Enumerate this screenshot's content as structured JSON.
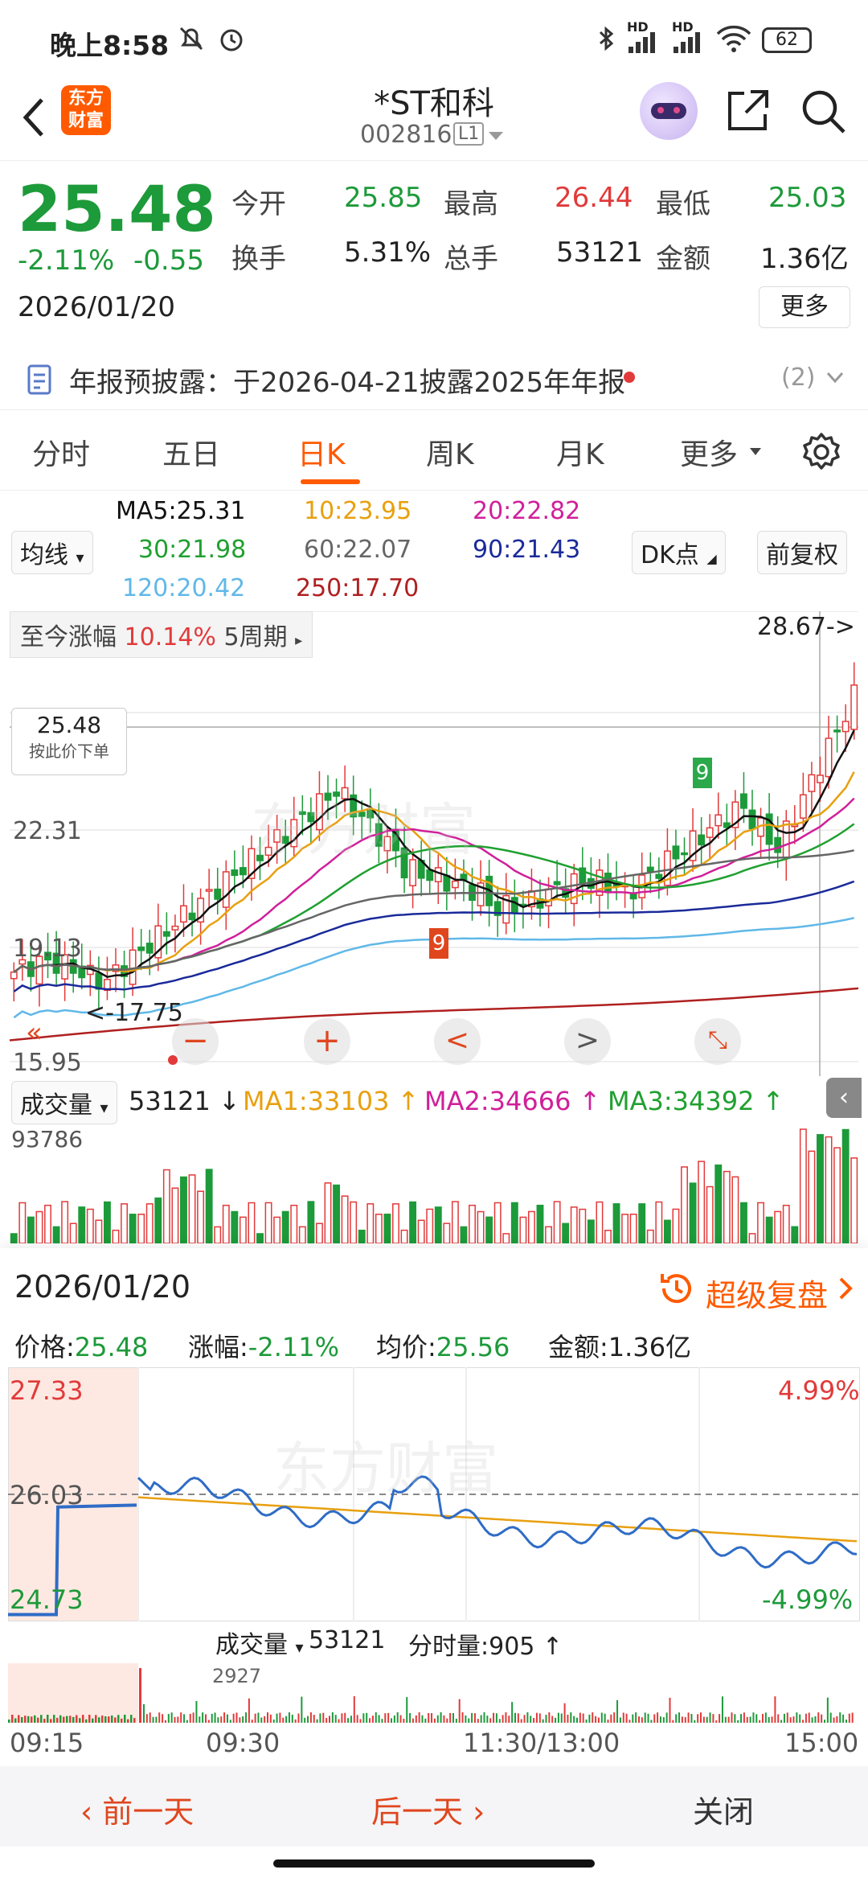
{
  "status": {
    "time": "晚上8:58",
    "battery": "62",
    "hd1": "HD",
    "hd2": "HD"
  },
  "header": {
    "title": "*ST和科",
    "code": "002816",
    "level": "L1",
    "logo_line1": "东方",
    "logo_line2": "财富"
  },
  "quote": {
    "price": "25.48",
    "change_pct": "-2.11%",
    "change": "-0.55",
    "date": "2026/01/20",
    "stats": [
      {
        "label": "今开",
        "value": "25.85"
      },
      {
        "label": "最高",
        "value": "26.44"
      },
      {
        "label": "最低",
        "value": "25.03"
      },
      {
        "label": "换手",
        "value": "5.31%"
      },
      {
        "label": "总手",
        "value": "53121"
      },
      {
        "label": "金额",
        "value": "1.36亿"
      }
    ],
    "more_label": "更多"
  },
  "notice": {
    "text": "年报预披露：于2026-04-21披露2025年年报",
    "count": "(2)"
  },
  "tabs": [
    "分时",
    "五日",
    "日K",
    "周K",
    "月K",
    "更多"
  ],
  "active_tab": "日K",
  "ma": {
    "ma5": "MA5:25.31",
    "ma10": "10:23.95",
    "ma20": "20:22.82",
    "ma30": "30:21.98",
    "ma60": "60:22.07",
    "ma90": "90:21.43",
    "ma120": "120:20.42",
    "ma250": "250:17.70",
    "selector": "均线",
    "dk_label": "DK点",
    "fq_label": "前复权"
  },
  "kchart": {
    "range_label": "至今涨幅",
    "range_value": "10.14%",
    "range_period": "5周期",
    "high_marker": "28.67->",
    "low_marker": "<-17.75",
    "price_tag": "25.48",
    "price_tag_sub": "按此价下单",
    "y_labels": [
      "22.31",
      "19.13",
      "15.95"
    ],
    "seq_up_end": "9",
    "seq_down_end": "9",
    "watermark": "东方财富"
  },
  "volume": {
    "label": "成交量",
    "value": "53121",
    "ma1": "MA1:33103",
    "ma2": "MA2:34666",
    "ma3": "MA3:34392",
    "max": "93786"
  },
  "panel": {
    "date": "2026/01/20",
    "replay": "超级复盘",
    "fields": [
      {
        "label": "价格:",
        "value": "25.48"
      },
      {
        "label": "涨幅:",
        "value": "-2.11%"
      },
      {
        "label": "均价:",
        "value": "25.56"
      },
      {
        "label": "金额:",
        "value": "1.36亿"
      }
    ],
    "y_top": "27.33",
    "y_mid": "26.03",
    "y_bot": "24.73",
    "pct_top": "4.99%",
    "pct_bot": "-4.99%",
    "vol_label": "成交量",
    "vol_value": "53121",
    "tick_vol": "分时量:905",
    "vol_max": "2927",
    "times": [
      "09:15",
      "09:30",
      "11:30/13:00",
      "15:00"
    ],
    "watermark": "东方财富"
  },
  "nav": {
    "prev": "前一天",
    "next": "后一天",
    "close": "关闭"
  },
  "colors": {
    "up": "#e23a3a",
    "down": "#1d9a3a",
    "accent": "#ff5a00",
    "ma5": "#111111",
    "ma10": "#e8a010",
    "ma20": "#d0209a",
    "ma30": "#20a030",
    "ma60": "#666666",
    "ma90": "#1a2a9a",
    "ma120": "#60b8e8",
    "ma250": "#b02020"
  }
}
